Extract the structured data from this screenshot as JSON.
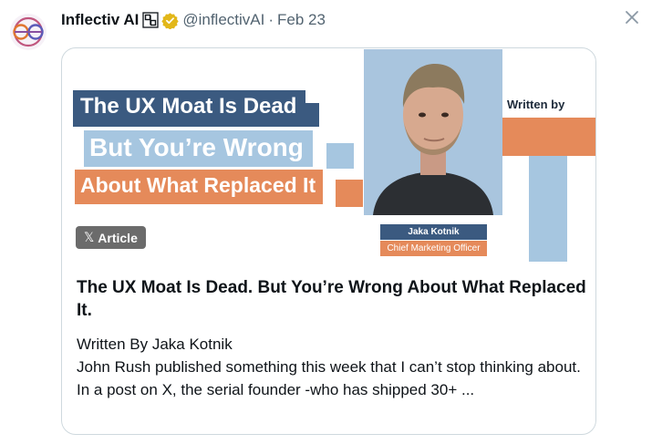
{
  "author": {
    "display_name": "Inflectiv AI",
    "handle": "@inflectivAI",
    "separator": "·",
    "date": "Feb 23"
  },
  "card": {
    "banner": {
      "line1": "The UX Moat Is Dead",
      "line2": "But You’re Wrong",
      "line3": "About What Replaced It",
      "written_by": "Written by",
      "author_name": "Jaka Kotnik",
      "author_role": "Chief Marketing Officer",
      "colors": {
        "navy": "#3b5a80",
        "light_blue": "#a6c6e0",
        "orange": "#e58a5a"
      }
    },
    "badge": {
      "icon": "x-logo-icon",
      "label": "Article",
      "x_glyph": "𝕏"
    },
    "title": "The UX Moat Is Dead. But You’re Wrong About What Replaced It.",
    "excerpt": [
      "Written By Jaka Kotnik",
      "John Rush published something this week that I can’t stop thinking about.",
      "In a post on X, the serial founder -who has shipped 30+ ..."
    ]
  },
  "icons": [
    "inflectiv-logo-icon",
    "affiliate-badge-icon",
    "verified-gold-icon",
    "close-icon"
  ]
}
